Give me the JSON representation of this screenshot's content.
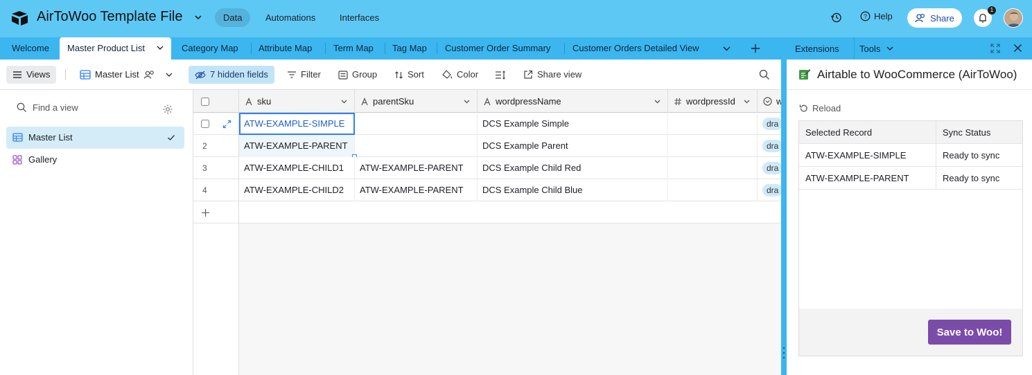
{
  "app": {
    "title": "AirToWoo Template File",
    "nav": [
      "Data",
      "Automations",
      "Interfaces"
    ],
    "help_label": "Help",
    "share_label": "Share",
    "notifications_count": "1"
  },
  "tabs": [
    "Welcome",
    "Master Product List",
    "Category Map",
    "Attribute Map",
    "Term Map",
    "Tag Map",
    "Customer Order Summary",
    "Customer Orders Detailed View"
  ],
  "toolbar": {
    "views_label": "Views",
    "view_name": "Master List",
    "hidden_fields": "7 hidden fields",
    "filter": "Filter",
    "group": "Group",
    "sort": "Sort",
    "color": "Color",
    "share_view": "Share view"
  },
  "sidebar": {
    "find_placeholder": "Find a view",
    "views": [
      "Master List",
      "Gallery"
    ]
  },
  "grid": {
    "columns": [
      "sku",
      "parentSku",
      "wordpressName",
      "wordpressId",
      "w"
    ],
    "rows": [
      {
        "num": "1",
        "sku": "ATW-EXAMPLE-SIMPLE",
        "parentSku": "",
        "name": "DCS Example Simple",
        "wpid": "",
        "status": "dra"
      },
      {
        "num": "2",
        "sku": "ATW-EXAMPLE-PARENT",
        "parentSku": "",
        "name": "DCS Example Parent",
        "wpid": "",
        "status": "dra"
      },
      {
        "num": "3",
        "sku": "ATW-EXAMPLE-CHILD1",
        "parentSku": "ATW-EXAMPLE-PARENT",
        "name": "DCS Example Child Red",
        "wpid": "",
        "status": "dra"
      },
      {
        "num": "4",
        "sku": "ATW-EXAMPLE-CHILD2",
        "parentSku": "ATW-EXAMPLE-PARENT",
        "name": "DCS Example Child Blue",
        "wpid": "",
        "status": "dra"
      }
    ]
  },
  "extension": {
    "header_extensions": "Extensions",
    "header_tools": "Tools",
    "title": "Airtable to WooCommerce (AirToWoo)",
    "reload": "Reload",
    "columns": [
      "Selected Record",
      "Sync Status"
    ],
    "rows": [
      {
        "record": "ATW-EXAMPLE-SIMPLE",
        "status": "Ready to sync"
      },
      {
        "record": "ATW-EXAMPLE-PARENT",
        "status": "Ready to sync"
      }
    ],
    "save_button": "Save to Woo!"
  },
  "colors": {
    "topbar": "#5ec8f5",
    "tabbar": "#3bb6ef",
    "save_button": "#7a4ba8",
    "selected_view": "#d4ecf8"
  }
}
